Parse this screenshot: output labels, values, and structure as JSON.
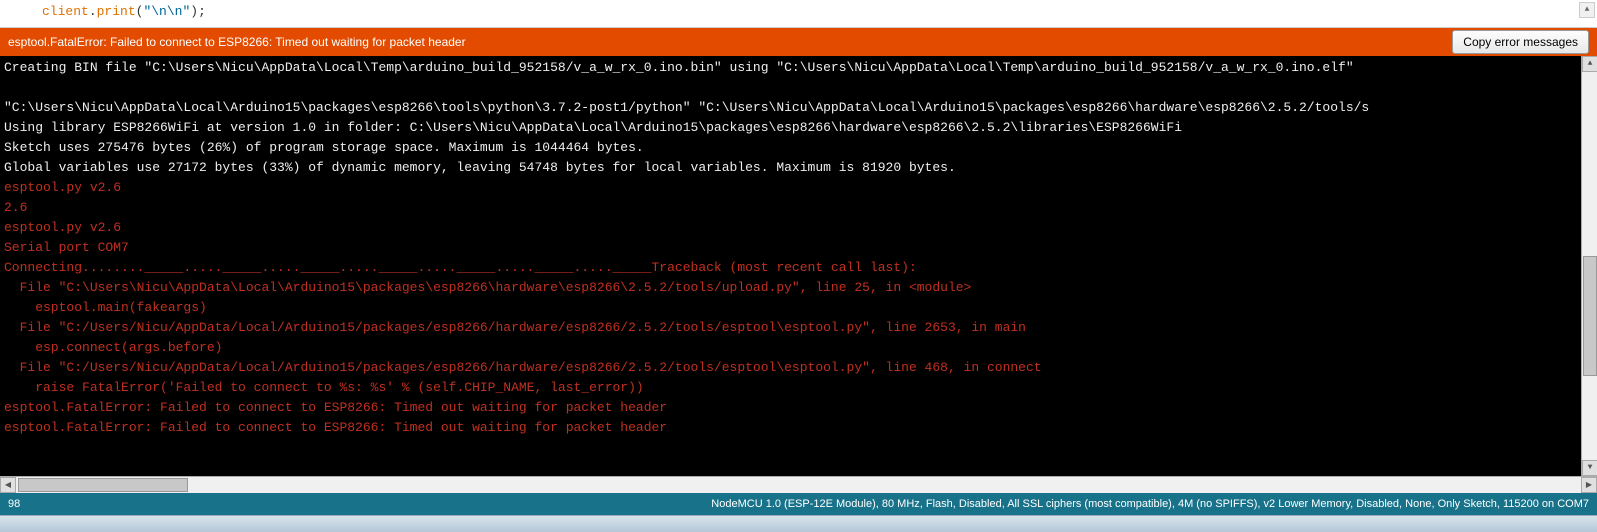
{
  "editor": {
    "code_obj": "client",
    "code_dot": ".",
    "code_fn": "print",
    "code_paren_open": "(",
    "code_string": "\"\\n\\n\"",
    "code_paren_close": ");"
  },
  "error_bar": {
    "message": "esptool.FatalError: Failed to connect to ESP8266: Timed out waiting for packet header",
    "copy_label": "Copy error messages"
  },
  "console_lines": [
    {
      "cls": "ln-white",
      "text": "Creating BIN file \"C:\\Users\\Nicu\\AppData\\Local\\Temp\\arduino_build_952158/v_a_w_rx_0.ino.bin\" using \"C:\\Users\\Nicu\\AppData\\Local\\Temp\\arduino_build_952158/v_a_w_rx_0.ino.elf\""
    },
    {
      "cls": "ln-white",
      "text": " "
    },
    {
      "cls": "ln-white",
      "text": "\"C:\\Users\\Nicu\\AppData\\Local\\Arduino15\\packages\\esp8266\\tools\\python\\3.7.2-post1/python\" \"C:\\Users\\Nicu\\AppData\\Local\\Arduino15\\packages\\esp8266\\hardware\\esp8266\\2.5.2/tools/s"
    },
    {
      "cls": "ln-white",
      "text": "Using library ESP8266WiFi at version 1.0 in folder: C:\\Users\\Nicu\\AppData\\Local\\Arduino15\\packages\\esp8266\\hardware\\esp8266\\2.5.2\\libraries\\ESP8266WiFi "
    },
    {
      "cls": "ln-white",
      "text": "Sketch uses 275476 bytes (26%) of program storage space. Maximum is 1044464 bytes."
    },
    {
      "cls": "ln-white",
      "text": "Global variables use 27172 bytes (33%) of dynamic memory, leaving 54748 bytes for local variables. Maximum is 81920 bytes."
    },
    {
      "cls": "ln-red",
      "text": "esptool.py v2.6"
    },
    {
      "cls": "ln-red",
      "text": "2.6"
    },
    {
      "cls": "ln-red",
      "text": "esptool.py v2.6"
    },
    {
      "cls": "ln-red",
      "text": "Serial port COM7"
    },
    {
      "cls": "ln-red",
      "text": "Connecting........_____....._____....._____....._____....._____....._____....._____Traceback (most recent call last):"
    },
    {
      "cls": "ln-red",
      "text": "  File \"C:\\Users\\Nicu\\AppData\\Local\\Arduino15\\packages\\esp8266\\hardware\\esp8266\\2.5.2/tools/upload.py\", line 25, in <module>"
    },
    {
      "cls": "ln-red",
      "text": "    esptool.main(fakeargs)"
    },
    {
      "cls": "ln-red",
      "text": "  File \"C:/Users/Nicu/AppData/Local/Arduino15/packages/esp8266/hardware/esp8266/2.5.2/tools/esptool\\esptool.py\", line 2653, in main"
    },
    {
      "cls": "ln-red",
      "text": "    esp.connect(args.before)"
    },
    {
      "cls": "ln-red",
      "text": "  File \"C:/Users/Nicu/AppData/Local/Arduino15/packages/esp8266/hardware/esp8266/2.5.2/tools/esptool\\esptool.py\", line 468, in connect"
    },
    {
      "cls": "ln-red",
      "text": "    raise FatalError('Failed to connect to %s: %s' % (self.CHIP_NAME, last_error))"
    },
    {
      "cls": "ln-red",
      "text": "esptool.FatalError: Failed to connect to ESP8266: Timed out waiting for packet header"
    },
    {
      "cls": "ln-red",
      "text": "esptool.FatalError: Failed to connect to ESP8266: Timed out waiting for packet header"
    },
    {
      "cls": "ln-white",
      "text": " "
    }
  ],
  "status": {
    "line_number": "98",
    "board_info": "NodeMCU 1.0 (ESP-12E Module), 80 MHz, Flash, Disabled, All SSL ciphers (most compatible), 4M (no SPIFFS), v2 Lower Memory, Disabled, None, Only Sketch, 115200 on COM7"
  },
  "glyphs": {
    "up": "▲",
    "down": "▼",
    "left": "◀",
    "right": "▶"
  }
}
